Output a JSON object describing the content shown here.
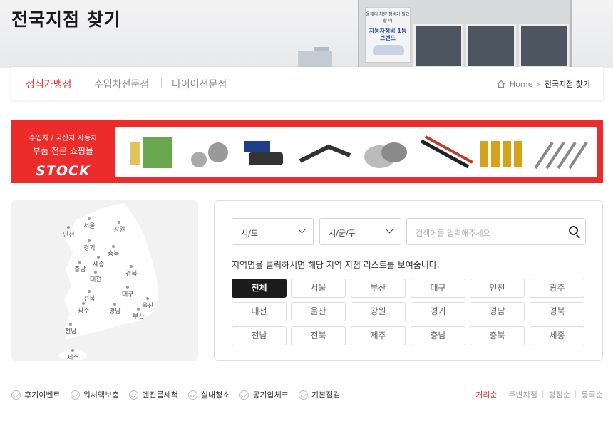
{
  "header": {
    "title": "전국지점 찾기",
    "sign_top": "올해의 차량 정비가 필요 할 때",
    "sign_main": "자동차정비 1등 브랜드"
  },
  "tabs": [
    {
      "label": "정식가맹점",
      "active": true
    },
    {
      "label": "수입차전문점",
      "active": false
    },
    {
      "label": "타이어전문점",
      "active": false
    }
  ],
  "breadcrumb": {
    "home": "Home",
    "current": "전국지점 찾기"
  },
  "banner": {
    "line1": "수입차 / 국산차 자동차",
    "line2": "부품 전문 쇼핑몰",
    "logo": "STOCK"
  },
  "map": {
    "cities": [
      "인천",
      "서울",
      "강원",
      "경기",
      "충북",
      "충남",
      "세종",
      "대전",
      "경북",
      "전북",
      "대구",
      "울산",
      "광주",
      "경남",
      "부산",
      "전남",
      "제주"
    ]
  },
  "search": {
    "select_sido": "시/도",
    "select_sigungu": "시/군/구",
    "placeholder": "검색어를 입력해주세요",
    "hint": "지역명을 클릭하시면 해당 지역 지점 리스트를 보여줍니다.",
    "regions": [
      "전체",
      "서울",
      "부산",
      "대구",
      "인천",
      "광주",
      "대전",
      "울산",
      "강원",
      "경기",
      "경남",
      "경북",
      "전남",
      "전북",
      "제주",
      "충남",
      "충북",
      "세종"
    ],
    "active_region": "전체"
  },
  "filters": [
    "후기이벤트",
    "워셔액보충",
    "엔진룸세척",
    "실내청소",
    "공기압체크",
    "기본점검"
  ],
  "sorts": [
    {
      "label": "거리순",
      "active": true
    },
    {
      "label": "주변지점",
      "active": false
    },
    {
      "label": "평점순",
      "active": false
    },
    {
      "label": "등록순",
      "active": false
    }
  ],
  "colors": {
    "accent": "#e0372c",
    "banner": "#ec2b2b",
    "active_btn": "#1c1c1c"
  }
}
